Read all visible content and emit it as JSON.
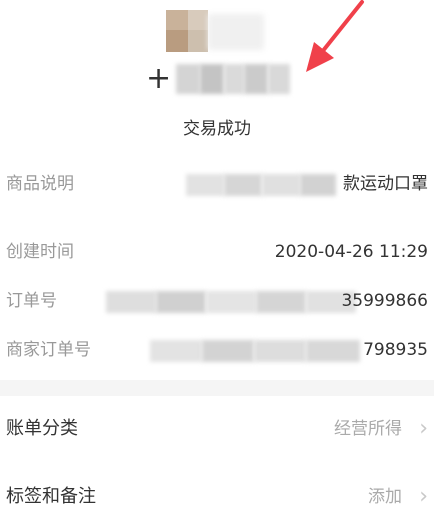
{
  "header": {
    "amount_sign": "+",
    "status": "交易成功"
  },
  "details": [
    {
      "label": "商品说明",
      "value": "款运动口罩"
    },
    {
      "label": "创建时间",
      "value": "2020-04-26 11:29"
    },
    {
      "label": "订单号",
      "value": "35999866"
    },
    {
      "label": "商家订单号",
      "value": "798935"
    }
  ],
  "nav": [
    {
      "label": "账单分类",
      "value": "经营所得"
    },
    {
      "label": "标签和备注",
      "value": "添加"
    }
  ],
  "icons": {
    "chevron": "chevron-right-icon",
    "annotation": "red-arrow-annotation-icon"
  },
  "colors": {
    "annotation_red": "#f0404a",
    "label_gray": "#999999",
    "muted_gray": "#aaaaaa",
    "text_dark": "#333333"
  }
}
